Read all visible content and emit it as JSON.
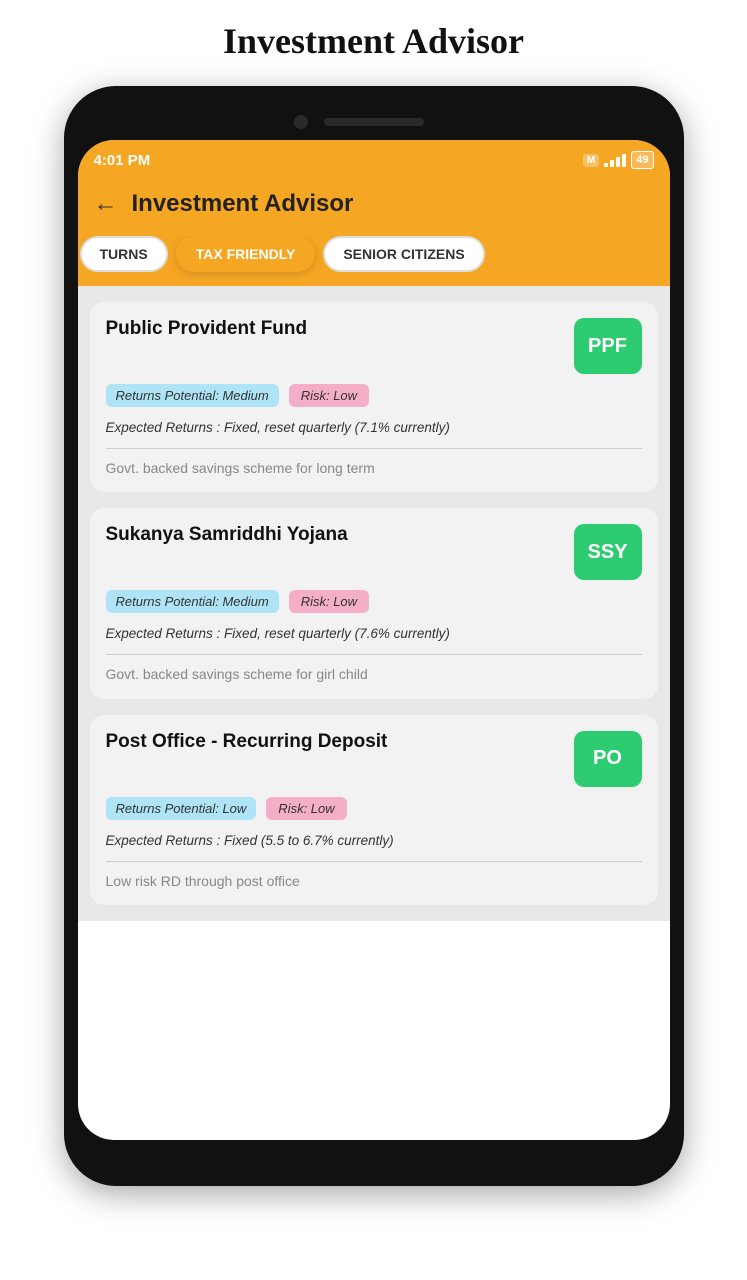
{
  "page": {
    "title": "Investment Advisor"
  },
  "status_bar": {
    "time": "4:01 PM",
    "battery": "49"
  },
  "header": {
    "title": "Investment Advisor",
    "back_label": "←"
  },
  "tabs": [
    {
      "id": "returns",
      "label": "TURNS",
      "state": "partial"
    },
    {
      "id": "tax_friendly",
      "label": "TAX FRIENDLY",
      "state": "active"
    },
    {
      "id": "senior_citizens",
      "label": "SENIOR CITIZENS",
      "state": "inactive"
    }
  ],
  "cards": [
    {
      "title": "Public Provident Fund",
      "badge": "PPF",
      "tag_returns": "Returns Potential: Medium",
      "tag_risk": "Risk: Low",
      "returns_text": "Expected Returns : Fixed, reset quarterly (7.1% currently)",
      "description": "Govt. backed savings scheme for long term"
    },
    {
      "title": "Sukanya Samriddhi Yojana",
      "badge": "SSY",
      "tag_returns": "Returns Potential: Medium",
      "tag_risk": "Risk: Low",
      "returns_text": "Expected Returns : Fixed, reset quarterly (7.6% currently)",
      "description": "Govt. backed savings scheme for girl child"
    },
    {
      "title": "Post Office - Recurring Deposit",
      "badge": "PO",
      "tag_returns": "Returns Potential: Low",
      "tag_risk": "Risk: Low",
      "returns_text": "Expected Returns : Fixed (5.5 to 6.7% currently)",
      "description": "Low risk RD through post office"
    }
  ]
}
